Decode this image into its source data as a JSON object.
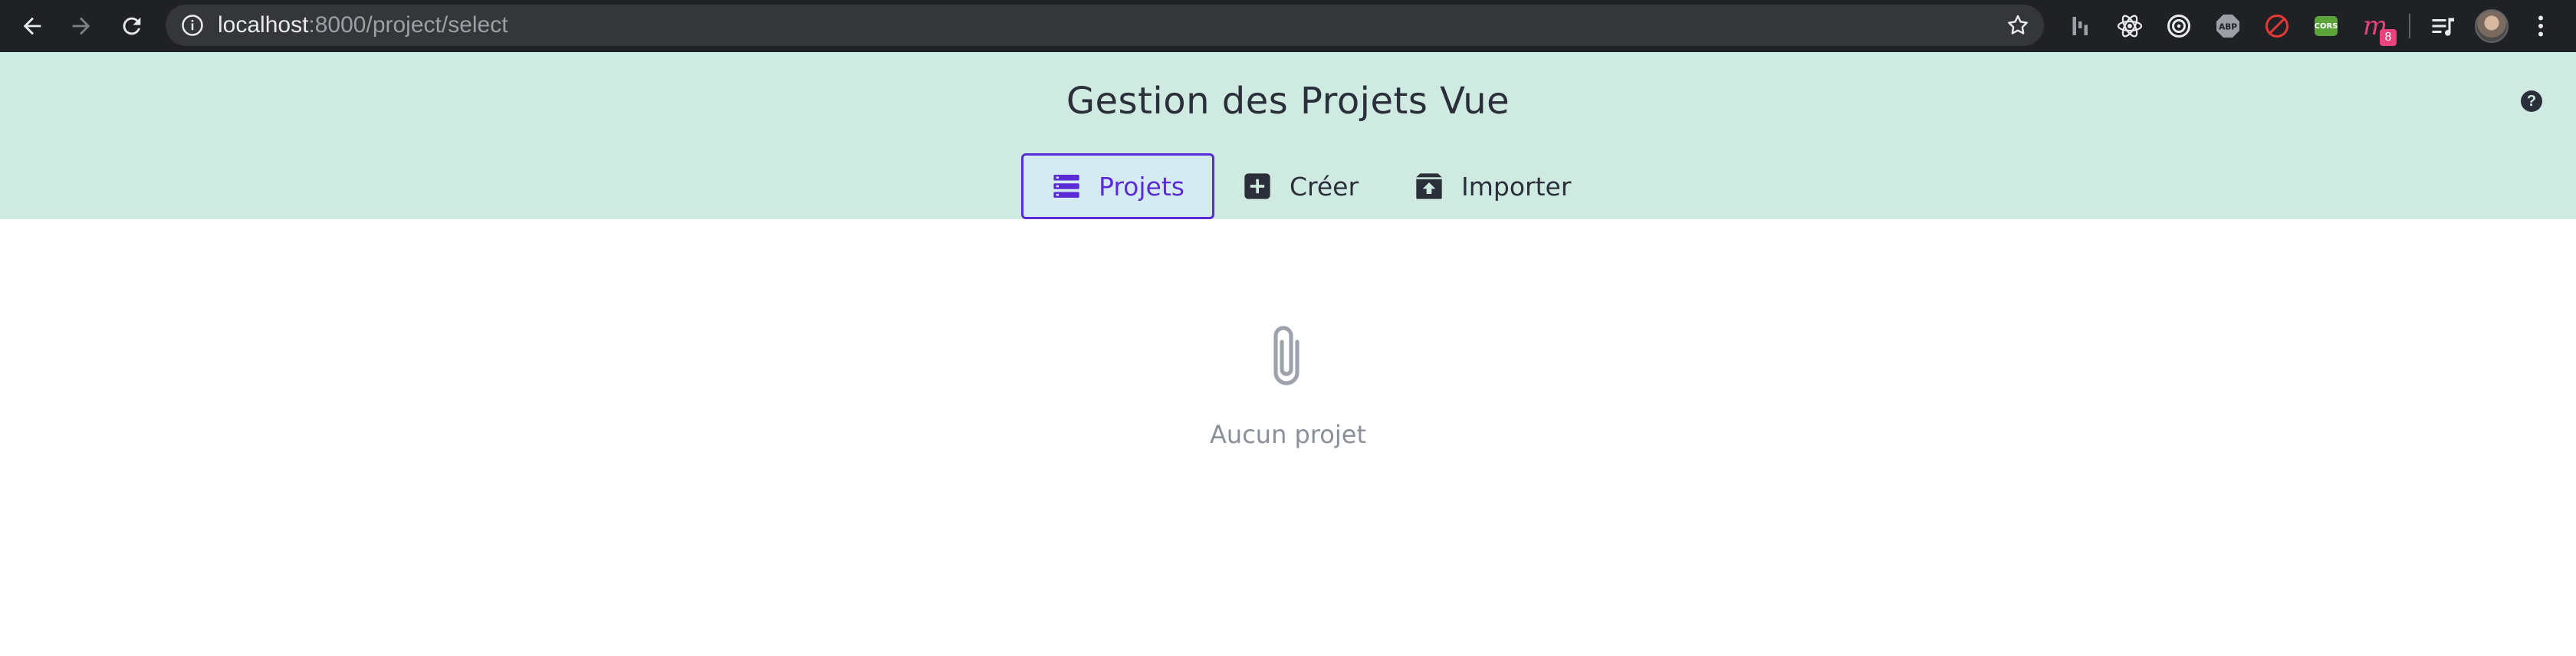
{
  "browser": {
    "url_host": "localhost",
    "url_path": ":8000/project/select",
    "extensions": [
      {
        "name": "bar-chart-extension-icon"
      },
      {
        "name": "react-devtools-icon"
      },
      {
        "name": "target-extension-icon"
      },
      {
        "name": "adblock-plus-icon",
        "label": "ABP"
      },
      {
        "name": "block-extension-icon"
      },
      {
        "name": "cors-extension-icon",
        "label": "CORS"
      },
      {
        "name": "m-extension-icon",
        "label": "m",
        "badge": "8"
      }
    ],
    "colors": {
      "chrome_bg": "#202124",
      "omnibox_bg": "#35363a"
    }
  },
  "header": {
    "title": "Gestion des Projets Vue",
    "help_label": "?",
    "colors": {
      "background": "#cfeae0",
      "accent": "#5b2bd6",
      "text": "#2b2f3a"
    }
  },
  "tabs": [
    {
      "label": "Projets",
      "icon": "list-icon",
      "active": true
    },
    {
      "label": "Créer",
      "icon": "plus-square-icon",
      "active": false
    },
    {
      "label": "Importer",
      "icon": "upload-box-icon",
      "active": false
    }
  ],
  "main": {
    "empty_icon": "paperclip-icon",
    "empty_text": "Aucun projet"
  }
}
